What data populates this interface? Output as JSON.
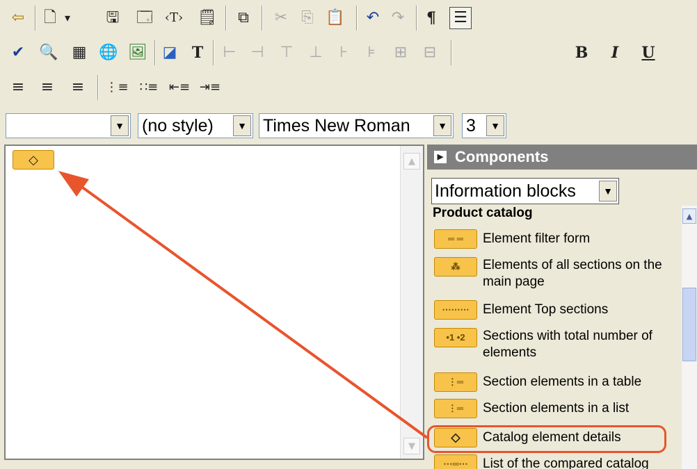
{
  "toolbar": {
    "row1": [
      {
        "name": "exit-icon",
        "glyph": "⇦"
      },
      {
        "name": "new-document-icon",
        "glyph": "🗋"
      },
      {
        "name": "dropdown-arrow-icon",
        "glyph": "▾"
      },
      {
        "name": "save-icon",
        "glyph": "🖫"
      },
      {
        "name": "save-as-template-icon",
        "glyph": "🗔"
      },
      {
        "name": "insert-tag-icon",
        "glyph": "‹T›"
      },
      {
        "name": "page-properties-icon",
        "glyph": "🗒"
      },
      {
        "name": "source-view-icon",
        "glyph": "⧉"
      },
      {
        "name": "cut-icon",
        "glyph": "✂"
      },
      {
        "name": "copy-icon",
        "glyph": "⎘"
      },
      {
        "name": "paste-icon",
        "glyph": "📋"
      },
      {
        "name": "undo-icon",
        "glyph": "↶"
      },
      {
        "name": "redo-icon",
        "glyph": "↷"
      },
      {
        "name": "show-paragraph-marks-icon",
        "glyph": "¶"
      },
      {
        "name": "show-borders-icon",
        "glyph": "☰"
      }
    ],
    "row2": [
      {
        "name": "spellcheck-icon",
        "glyph": "✔"
      },
      {
        "name": "find-replace-icon",
        "glyph": "🔍"
      },
      {
        "name": "insert-table-icon",
        "glyph": "▦"
      },
      {
        "name": "insert-link-icon",
        "glyph": "🌐"
      },
      {
        "name": "insert-image-icon",
        "glyph": "🖼"
      },
      {
        "name": "background-color-icon",
        "glyph": "◪"
      },
      {
        "name": "text-color-icon",
        "glyph": "T"
      },
      {
        "name": "table-cell-1-icon",
        "glyph": "⊢"
      },
      {
        "name": "table-cell-2-icon",
        "glyph": "⊣"
      },
      {
        "name": "table-cell-3-icon",
        "glyph": "⊤"
      },
      {
        "name": "table-cell-4-icon",
        "glyph": "⊥"
      },
      {
        "name": "table-cell-5-icon",
        "glyph": "⊦"
      },
      {
        "name": "table-cell-6-icon",
        "glyph": "⊧"
      },
      {
        "name": "table-merge-icon",
        "glyph": "⊞"
      },
      {
        "name": "table-split-icon",
        "glyph": "⊟"
      }
    ],
    "bold_label": "B",
    "italic_label": "I",
    "underline_label": "U",
    "row3": [
      {
        "name": "align-left-icon",
        "glyph": "≡"
      },
      {
        "name": "align-center-icon",
        "glyph": "≡"
      },
      {
        "name": "align-right-icon",
        "glyph": "≡"
      },
      {
        "name": "ordered-list-icon",
        "glyph": "⋮≡"
      },
      {
        "name": "unordered-list-icon",
        "glyph": "∷≡"
      },
      {
        "name": "outdent-icon",
        "glyph": "⇤≡"
      },
      {
        "name": "indent-icon",
        "glyph": "⇥≡"
      }
    ]
  },
  "format_bar": {
    "format_value": "",
    "style_value": "(no style)",
    "font_value": "Times New Roman",
    "size_value": "3"
  },
  "editor": {
    "component_glyph": "◇"
  },
  "panel": {
    "header_title": "Components",
    "header_arrow_glyph": "▶",
    "category_select": "Information blocks",
    "group_title": "Product catalog",
    "items": [
      {
        "label": "Element filter form",
        "icon_glyph": "═ ═"
      },
      {
        "label": "Elements of all sections on the main page",
        "icon_glyph": "⁂"
      },
      {
        "label": "Element Top sections",
        "icon_glyph": "⋯⋯⋯"
      },
      {
        "label": "Sections with total number of elements",
        "icon_glyph": "•1 •2"
      },
      {
        "label": "Section elements in a table",
        "icon_glyph": "⋮═"
      },
      {
        "label": "Section elements in a list",
        "icon_glyph": "⋮═"
      },
      {
        "label": "Catalog element details",
        "icon_glyph": "◇"
      },
      {
        "label": "List of the compared catalog",
        "icon_glyph": "⋯═⋯"
      }
    ]
  },
  "annotation": {
    "arrow_color": "#e8552d",
    "highlight_color": "#e8552d"
  }
}
